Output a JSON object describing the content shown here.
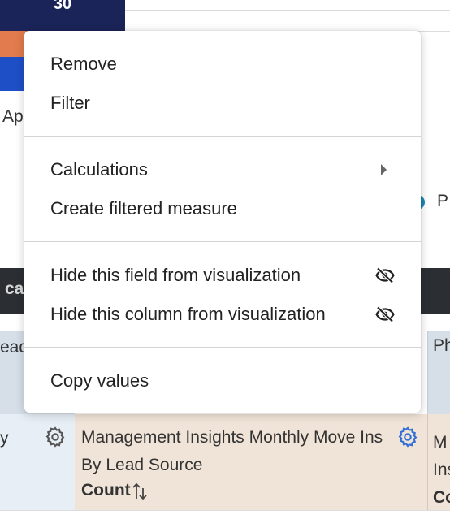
{
  "background": {
    "bar_top_value": "30",
    "axis_label_partial": "Ap",
    "legend_partial": "P",
    "dark_bar_partial": "ca",
    "header_left_partial": "ead",
    "header_right_partial": "Ph",
    "row_left_partial": "y",
    "row_right_partial_line1": "M",
    "row_right_partial_line2": "Ins",
    "row_right_partial_line3": "Co",
    "column": {
      "title": "Management Insights Monthly Move Ins By Lead Source",
      "measure": "Count"
    },
    "colors": {
      "navy": "#1b2459",
      "orange": "#e27b4e",
      "blue": "#1f4fc7",
      "dark_bar": "#2b2f33",
      "header_bg": "#d6dfe8",
      "row_bg": "#f0e3d7",
      "gear_blue": "#2f6fd6"
    }
  },
  "menu": {
    "groups": [
      {
        "items": [
          {
            "label": "Remove"
          },
          {
            "label": "Filter"
          }
        ]
      },
      {
        "items": [
          {
            "label": "Calculations",
            "submenu": true
          },
          {
            "label": "Create filtered measure"
          }
        ]
      },
      {
        "items": [
          {
            "label": "Hide this field from visualization",
            "icon": "eye-slash-icon"
          },
          {
            "label": "Hide this column from visualization",
            "icon": "eye-slash-icon"
          }
        ]
      },
      {
        "items": [
          {
            "label": "Copy values"
          }
        ]
      }
    ]
  }
}
